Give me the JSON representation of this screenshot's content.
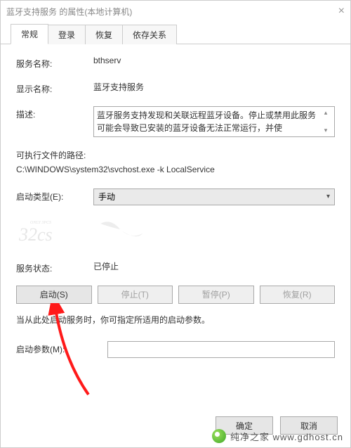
{
  "title": "蓝牙支持服务 的属性(本地计算机)",
  "tabs": {
    "general": "常规",
    "logon": "登录",
    "recovery": "恢复",
    "dependencies": "依存关系"
  },
  "labels": {
    "service_name": "服务名称:",
    "display_name": "显示名称:",
    "description": "描述:",
    "exe_path": "可执行文件的路径:",
    "startup_type": "启动类型(E):",
    "service_status": "服务状态:",
    "hint": "当从此处启动服务时，你可指定所适用的启动参数。",
    "startup_param": "启动参数(M):"
  },
  "values": {
    "service_name": "bthserv",
    "display_name": "蓝牙支持服务",
    "description": "蓝牙服务支持发现和关联远程蓝牙设备。停止或禁用此服务可能会导致已安装的蓝牙设备无法正常运行，并使",
    "exe_path": "C:\\WINDOWS\\system32\\svchost.exe -k LocalService",
    "startup_type": "手动",
    "service_status": "已停止",
    "startup_param": ""
  },
  "buttons": {
    "start": "启动(S)",
    "stop": "停止(T)",
    "pause": "暂停(P)",
    "resume": "恢复(R)",
    "ok": "确定",
    "cancel": "取消"
  },
  "footer_watermark": "纯净之家 www.gdhost.cn"
}
